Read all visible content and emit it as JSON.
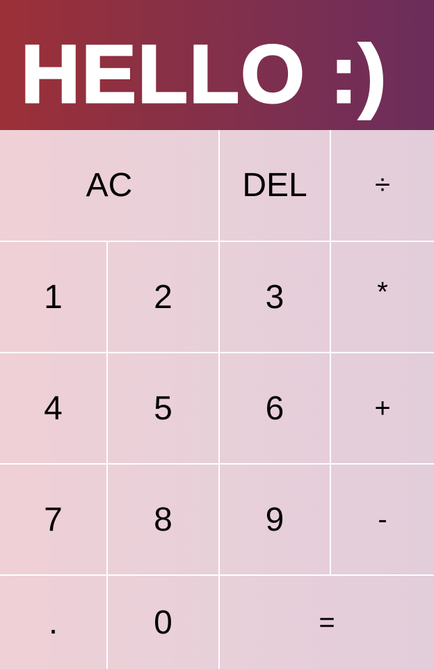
{
  "display": {
    "text": "HELLO :)"
  },
  "colors": {
    "display_gradient_start": "#9c3038",
    "display_gradient_end": "#6b2d5c",
    "keypad_background": "#ead0d8",
    "key_border": "#ffffff",
    "display_text": "#ffffff",
    "key_text": "#000000"
  },
  "keys": {
    "ac": "AC",
    "del": "DEL",
    "divide": "÷",
    "one": "1",
    "two": "2",
    "three": "3",
    "multiply": "*",
    "four": "4",
    "five": "5",
    "six": "6",
    "plus": "+",
    "seven": "7",
    "eight": "8",
    "nine": "9",
    "minus": "-",
    "decimal": ".",
    "zero": "0",
    "equals": "="
  }
}
